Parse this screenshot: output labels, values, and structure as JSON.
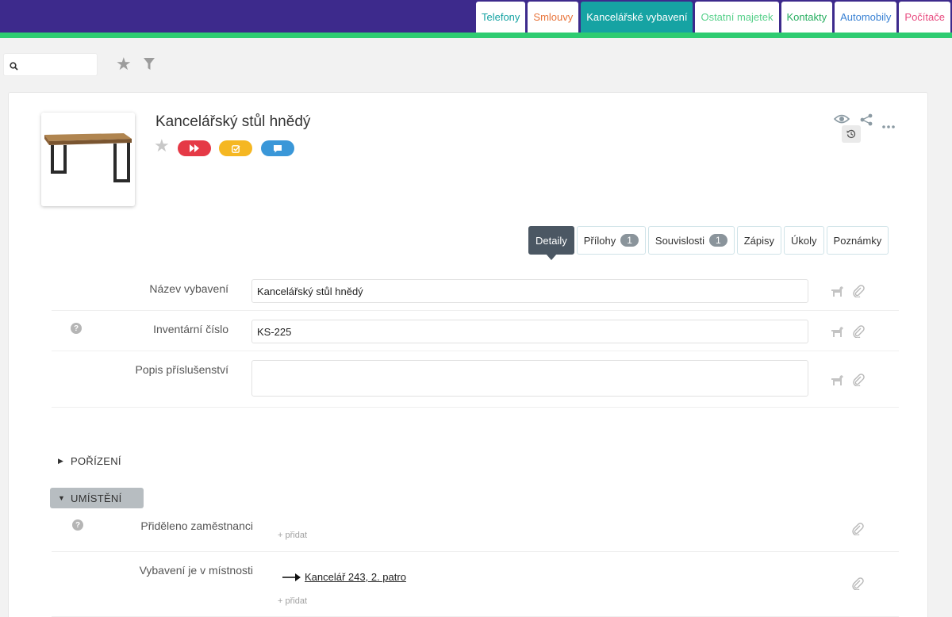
{
  "top_tabs": [
    {
      "label": "Telefony",
      "color": "#16a3a3",
      "active": false
    },
    {
      "label": "Smlouvy",
      "color": "#e8743b",
      "active": false
    },
    {
      "label": "Kancelářské vybavení",
      "color": "#16a3a3",
      "active": true
    },
    {
      "label": "Ostatní majetek",
      "color": "#56d08a",
      "active": false
    },
    {
      "label": "Kontakty",
      "color": "#27ae60",
      "active": false
    },
    {
      "label": "Automobily",
      "color": "#3a82d4",
      "active": false
    },
    {
      "label": "Počítače",
      "color": "#e84a7f",
      "active": false
    }
  ],
  "colors": {
    "topbar": "#3d2a8c",
    "stripe": "#2ecc71",
    "active_tab": "#16a3a3"
  },
  "search": {
    "value": "",
    "placeholder": ""
  },
  "item": {
    "title": "Kancelářský stůl hnědý"
  },
  "subtabs": [
    {
      "label": "Detaily",
      "badge": null,
      "active": true
    },
    {
      "label": "Přílohy",
      "badge": "1",
      "active": false
    },
    {
      "label": "Souvislosti",
      "badge": "1",
      "active": false
    },
    {
      "label": "Zápisy",
      "badge": null,
      "active": false
    },
    {
      "label": "Úkoly",
      "badge": null,
      "active": false
    },
    {
      "label": "Poznámky",
      "badge": null,
      "active": false
    }
  ],
  "fields": {
    "name": {
      "label": "Název vybavení",
      "value": "Kancelářský stůl hnědý"
    },
    "inventory": {
      "label": "Inventární číslo",
      "value": "KS-225"
    },
    "accessories": {
      "label": "Popis příslušenství",
      "value": ""
    }
  },
  "sections": {
    "acquisition": "POŘÍZENÍ",
    "location": "UMÍSTĚNÍ"
  },
  "location": {
    "employee_label": "Přiděleno zaměstnanci",
    "room_label": "Vybavení je v místnosti",
    "room_value": "Kancelář 243, 2. patro",
    "add_label": "+ přidat"
  }
}
